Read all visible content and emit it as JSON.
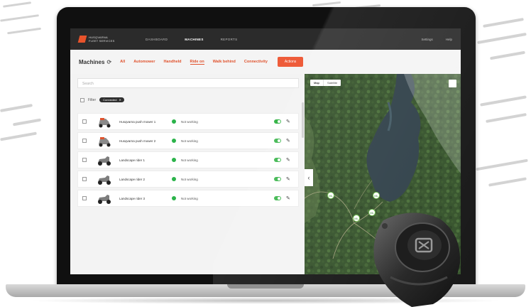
{
  "nav": {
    "logo_line1": "HUSQVARNA",
    "logo_line2": "FLEET SERVICES",
    "items": [
      "DASHBOARD",
      "MACHINES",
      "REPORTS"
    ],
    "active_index": 1,
    "right_items": [
      "Settings",
      "Help"
    ]
  },
  "toolbar": {
    "title": "Machines",
    "filters": [
      "All",
      "Automower",
      "Handheld",
      "Ride on",
      "Walk behind",
      "Connectivity"
    ],
    "active_filter_index": 3,
    "action_button": "Actions"
  },
  "list": {
    "search_placeholder": "Search",
    "filter_label": "Filter",
    "filter_chip": "Connected",
    "rows": [
      {
        "name": "Husqvarna push mower 1",
        "status": "Not working"
      },
      {
        "name": "Husqvarna push mower 2",
        "status": "Not working"
      },
      {
        "name": "Landscape rider 1",
        "status": "Not working"
      },
      {
        "name": "Landscape rider 2",
        "status": "Not working"
      },
      {
        "name": "Landscape rider 3",
        "status": "Not working"
      }
    ]
  },
  "map": {
    "toggle_options": [
      "Map",
      "Satellite"
    ],
    "selected_toggle": 0,
    "pins": [
      "ML",
      "ML",
      "ML",
      "ML"
    ]
  },
  "colors": {
    "accent": "#e0532e",
    "status_ok": "#2bb34a",
    "nav_bg": "#2b2b2b"
  }
}
